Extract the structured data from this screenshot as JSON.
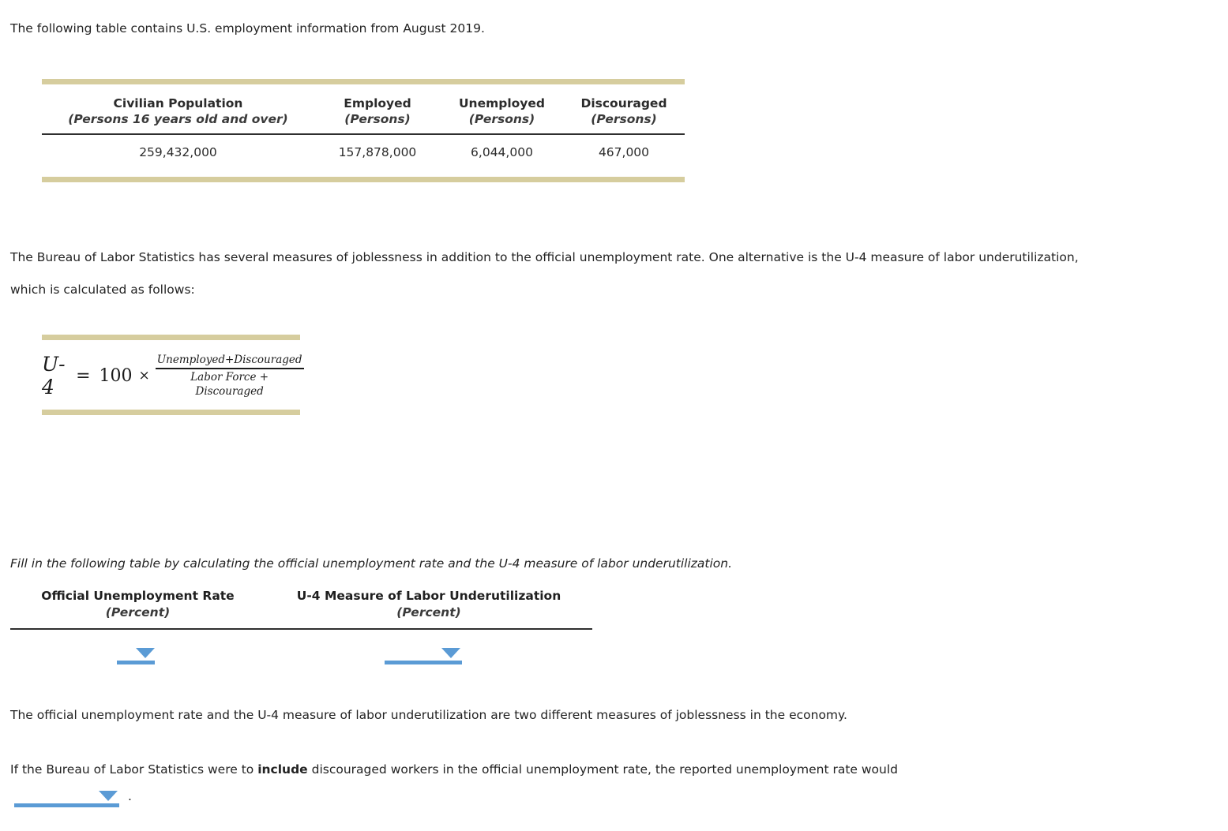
{
  "intro": {
    "text": "The following table contains U.S. employment information from August 2019."
  },
  "employment_table": {
    "columns": [
      {
        "header": "Civilian Population",
        "subheader": "(Persons 16 years old and over)",
        "value": "259,432,000"
      },
      {
        "header": "Employed",
        "subheader": "(Persons)",
        "value": "157,878,000"
      },
      {
        "header": "Unemployed",
        "subheader": "(Persons)",
        "value": "6,044,000"
      },
      {
        "header": "Discouraged",
        "subheader": "(Persons)",
        "value": "467,000"
      }
    ],
    "border_color": "#d6cd9e",
    "rule_color": "#2f2f2f"
  },
  "bls_paragraph": {
    "text": "The Bureau of Labor Statistics has several measures of joblessness in addition to the official unemployment rate. One alternative is the U-4 measure of labor underutilization, which is calculated as follows:"
  },
  "formula": {
    "lhs": "U-4",
    "equals": "=",
    "coefficient": "100",
    "times": "×",
    "numerator": "Unemployed+Discouraged",
    "denominator": "Labor Force + Discouraged",
    "border_color": "#d6cd9e"
  },
  "fill_instruction": {
    "text": "Fill in the following table by calculating the official unemployment rate and the U-4 measure of labor underutilization."
  },
  "answer_table": {
    "columns": [
      {
        "header": "Official Unemployment Rate",
        "subheader": "(Percent)",
        "value": ""
      },
      {
        "header": "U-4 Measure of Labor Underutilization",
        "subheader": "(Percent)",
        "value": ""
      }
    ]
  },
  "dropdowns": {
    "official_rate": {
      "value": "",
      "icon": "chevron-down-icon",
      "color": "#5b9bd5"
    },
    "u4_measure": {
      "value": "",
      "icon": "chevron-down-icon",
      "color": "#5b9bd5"
    },
    "direction": {
      "value": "",
      "icon": "chevron-down-icon",
      "color": "#5b9bd5"
    }
  },
  "closing": {
    "text": "The official unemployment rate and the U-4 measure of labor underutilization are two different measures of joblessness in the economy."
  },
  "include_sentence": {
    "lead": "If the Bureau of Labor Statistics were to ",
    "emphasis": "include",
    "tail": " discouraged workers in the official unemployment rate, the reported unemployment rate would",
    "period": "."
  }
}
